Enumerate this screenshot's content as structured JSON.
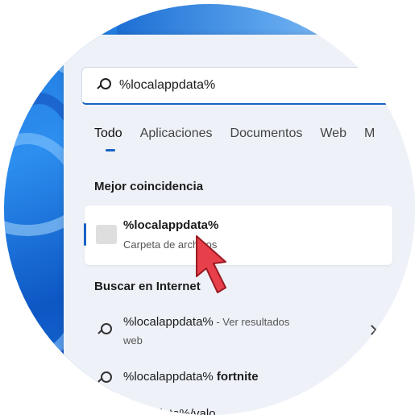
{
  "search": {
    "value": "%localappdata%"
  },
  "tabs": [
    {
      "label": "Todo",
      "active": true
    },
    {
      "label": "Aplicaciones"
    },
    {
      "label": "Documentos"
    },
    {
      "label": "Web"
    },
    {
      "label": "M"
    }
  ],
  "best_match": {
    "heading": "Mejor coincidencia",
    "title": "%localappdata%",
    "subtitle": "Carpeta de archivos",
    "icon": "folder-icon"
  },
  "web_search": {
    "heading": "Buscar en Internet",
    "items": [
      {
        "text": "%localappdata%",
        "suffix": " - Ver resultados",
        "second_line": "web",
        "icon": "search-icon",
        "has_chevron": true
      },
      {
        "text": "%localappdata%",
        "bold": " fortnite",
        "icon": "search-icon"
      },
      {
        "text": "ndata%/valo"
      }
    ]
  },
  "colors": {
    "accent": "#1a62c4",
    "cursor": "#e8404a"
  }
}
